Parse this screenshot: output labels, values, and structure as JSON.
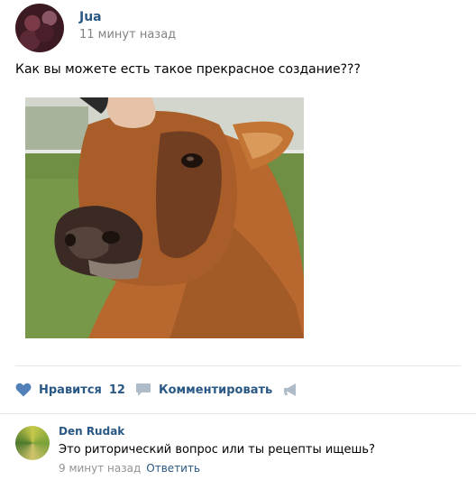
{
  "post": {
    "author": "Jua",
    "time": "11 минут назад",
    "text": "Как вы можете есть такое прекрасное создание???",
    "image_desc": "cow-photo"
  },
  "actions": {
    "like_label": "Нравится",
    "like_count": "12",
    "comment_label": "Комментировать"
  },
  "comment": {
    "author": "Den Rudak",
    "text": "Это риторический вопрос или ты рецепты ищешь?",
    "time": "9 минут назад",
    "reply_label": "Ответить"
  },
  "colors": {
    "link": "#2a5885",
    "muted": "#828282",
    "icon": "#5181b8",
    "icon_muted": "#aebbc9"
  }
}
